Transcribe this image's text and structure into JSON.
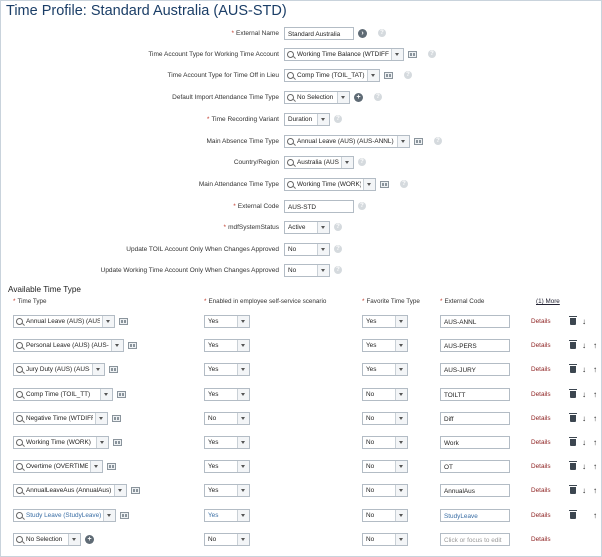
{
  "title": "Time Profile: Standard Australia (AUS-STD)",
  "form": [
    {
      "label": "External Name",
      "required": true,
      "value": "Standard Australia",
      "kind": "input"
    },
    {
      "label": "Time Account Type for Working Time Account",
      "required": false,
      "value": "Working Time Balance (WTDIFF)",
      "kind": "select"
    },
    {
      "label": "Time Account Type for Time Off in Lieu",
      "required": false,
      "value": "Comp Time (TOIL_TAT)",
      "kind": "select"
    },
    {
      "label": "Default Import Attendance Time Type",
      "required": false,
      "value": "No Selection",
      "kind": "select"
    },
    {
      "label": "Time Recording Variant",
      "required": true,
      "value": "Duration",
      "kind": "dropdown"
    },
    {
      "label": "Main Absence Time Type",
      "required": false,
      "value": "Annual Leave (AUS) (AUS-ANNL)",
      "kind": "select"
    },
    {
      "label": "Country/Region",
      "required": false,
      "value": "Australia (AUS)",
      "kind": "select"
    },
    {
      "label": "Main Attendance Time Type",
      "required": false,
      "value": "Working Time (WORK)",
      "kind": "select"
    },
    {
      "label": "External Code",
      "required": true,
      "value": "AUS-STD",
      "kind": "input"
    },
    {
      "label": "mdfSystemStatus",
      "required": true,
      "value": "Active",
      "kind": "dropdown"
    },
    {
      "label": "Update TOIL Account Only When Changes Approved",
      "required": false,
      "value": "No",
      "kind": "dropdown"
    },
    {
      "label": "Update Working Time Account Only When Changes Approved",
      "required": false,
      "value": "No",
      "kind": "dropdown"
    }
  ],
  "section_title": "Available Time Type",
  "columns": {
    "time_type": "Time Type",
    "self_service": "Enabled in employee self-service scenario",
    "favorite": "Favorite Time Type",
    "external_code": "External Code",
    "more": "(1) More"
  },
  "details_label": "Details",
  "rows": [
    {
      "time_type": "Annual Leave (AUS) (AUS-ANNL)",
      "self_service": "Yes",
      "favorite": "Yes",
      "external_code": "AUS-ANNL",
      "up": false,
      "down": true
    },
    {
      "time_type": "Personal Leave (AUS) (AUS-PERS...",
      "self_service": "Yes",
      "favorite": "Yes",
      "external_code": "AUS-PERS",
      "up": true,
      "down": true
    },
    {
      "time_type": "Jury Duty (AUS) (AUS-JURY)",
      "self_service": "Yes",
      "favorite": "Yes",
      "external_code": "AUS-JURY",
      "up": true,
      "down": true
    },
    {
      "time_type": "Comp Time (TOIL_TT)",
      "self_service": "Yes",
      "favorite": "No",
      "external_code": "TOILTT",
      "up": true,
      "down": true
    },
    {
      "time_type": "Negative Time (WTDIFF)",
      "self_service": "No",
      "favorite": "No",
      "external_code": "Diff",
      "up": true,
      "down": true
    },
    {
      "time_type": "Working Time (WORK)",
      "self_service": "Yes",
      "favorite": "No",
      "external_code": "Work",
      "up": true,
      "down": true
    },
    {
      "time_type": "Overtime (OVERTIME)",
      "self_service": "Yes",
      "favorite": "No",
      "external_code": "OT",
      "up": true,
      "down": true
    },
    {
      "time_type": "AnnualLeaveAus (AnnualAus)",
      "self_service": "Yes",
      "favorite": "No",
      "external_code": "AnnualAus",
      "up": true,
      "down": true
    },
    {
      "time_type": "Study Leave (StudyLeave)",
      "self_service": "Yes",
      "favorite": "No",
      "external_code": "StudyLeave",
      "up": true,
      "down": false
    },
    {
      "time_type": "No Selection",
      "self_service": "No",
      "favorite": "No",
      "external_code": "",
      "up": false,
      "down": false
    }
  ],
  "new_row_placeholder": "Click or focus to edit",
  "icons": {
    "help": "?",
    "add": "+",
    "nav": "›"
  },
  "colors": {
    "title": "#1b3e67",
    "required": "#c0392b",
    "details": "#8b1d1d",
    "link_blue": "#3a6ea5"
  }
}
